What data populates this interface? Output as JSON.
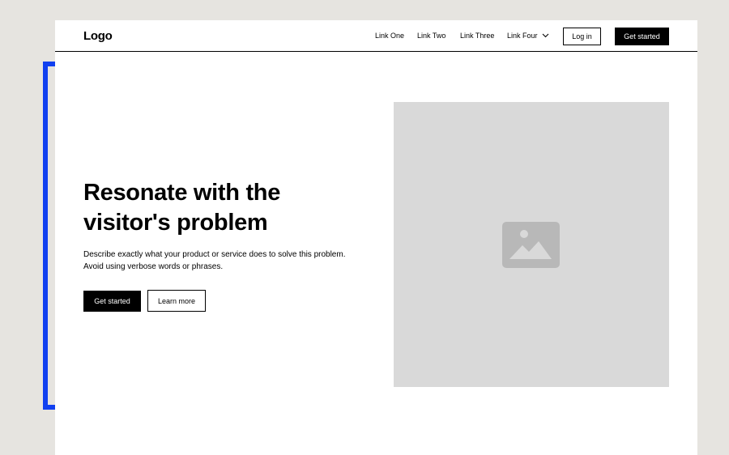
{
  "navbar": {
    "logo": "Logo",
    "links": [
      {
        "label": "Link One"
      },
      {
        "label": "Link Two"
      },
      {
        "label": "Link Three"
      },
      {
        "label": "Link Four",
        "icon": "chevron-down-icon"
      }
    ],
    "login_label": "Log in",
    "cta_label": "Get started"
  },
  "hero": {
    "title": "Resonate with the visitor's problem",
    "description": "Describe exactly what your product or service does to solve this problem. Avoid using verbose words or phrases.",
    "primary_button": "Get started",
    "secondary_button": "Learn more",
    "image_icon": "image-placeholder-icon"
  },
  "colors": {
    "background": "#e6e4e0",
    "accent_bracket": "#1140f0",
    "placeholder_fill": "#d9d9d9",
    "placeholder_icon": "#b8b8b8"
  }
}
